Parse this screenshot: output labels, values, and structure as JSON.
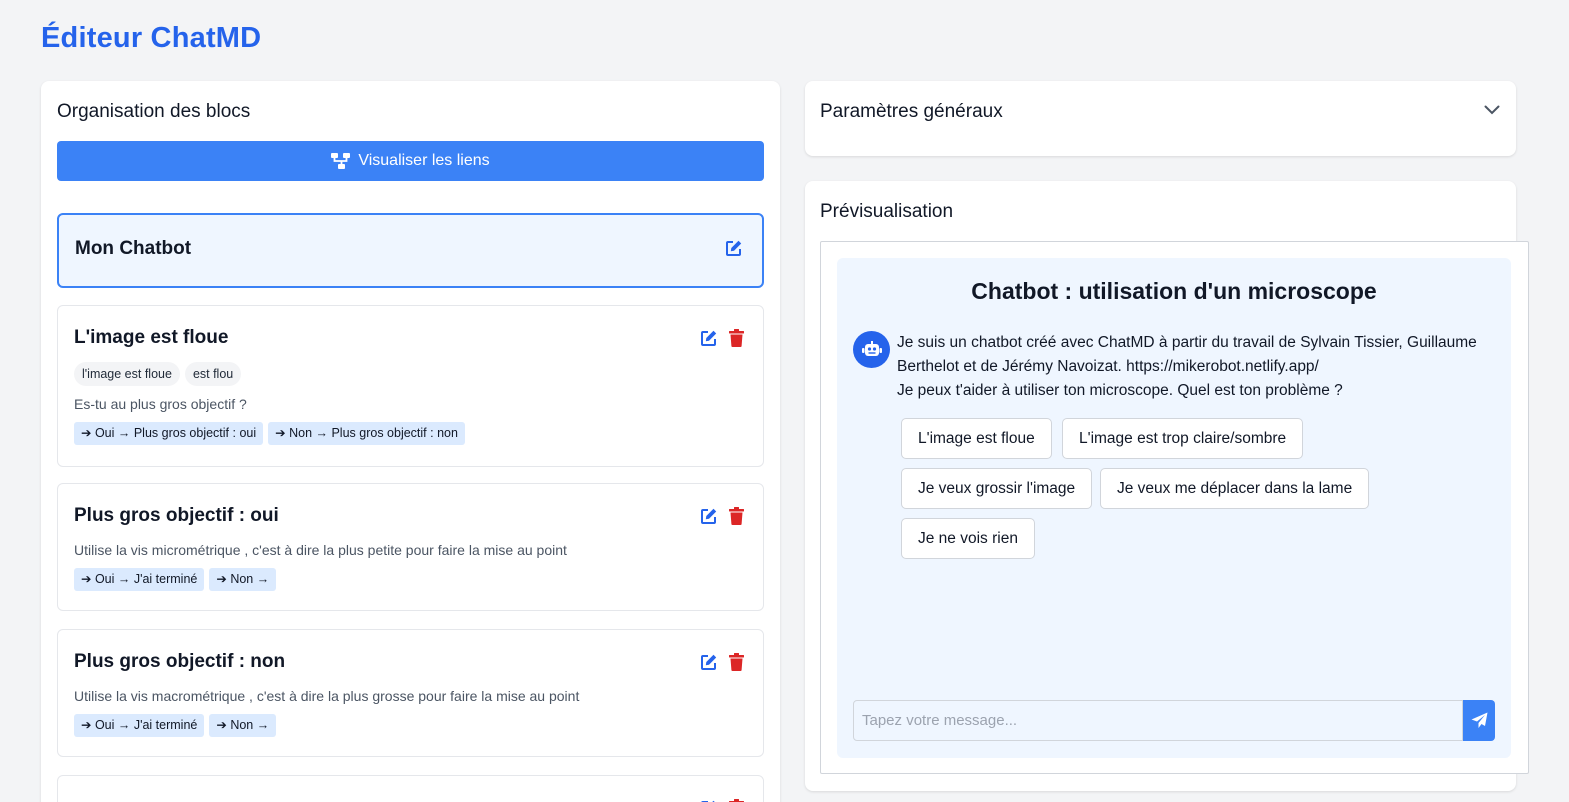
{
  "app": {
    "title": "Éditeur ChatMD"
  },
  "colors": {
    "accent": "#3b82f6",
    "title": "#2563eb",
    "danger": "#dc2626",
    "preview_bg": "#eff6ff"
  },
  "organisation": {
    "title": "Organisation des blocs",
    "visualize_label": "Visualiser les liens",
    "root_block": {
      "title": "Mon Chatbot"
    },
    "blocks": [
      {
        "title": "L'image est floue",
        "keywords": [
          "l'image est floue",
          "est flou"
        ],
        "question": "Es-tu au plus gros objectif ?",
        "links": [
          "➔ Oui → Plus gros objectif : oui",
          "➔ Non → Plus gros objectif : non"
        ]
      },
      {
        "title": "Plus gros objectif : oui",
        "keywords": [],
        "question": "Utilise la vis micrométrique , c'est à dire la plus petite pour faire la mise au point",
        "links": [
          "➔ Oui → J'ai terminé",
          "➔ Non →"
        ]
      },
      {
        "title": "Plus gros objectif : non",
        "keywords": [],
        "question": "Utilise la vis macrométrique , c'est à dire la plus grosse pour faire la mise au point",
        "links": [
          "➔ Oui → J'ai terminé",
          "➔ Non →"
        ]
      }
    ]
  },
  "settings": {
    "title": "Paramètres généraux",
    "icon": "chevron-down-icon"
  },
  "preview": {
    "title": "Prévisualisation",
    "chat_title": "Chatbot : utilisation d'un microscope",
    "bot_message_line1": "Je suis un chatbot créé avec ChatMD à partir du travail de Sylvain Tissier, Guillaume Berthelot et de Jérémy Navoizat. https://mikerobot.netlify.app/",
    "bot_message_line2": "Je peux t'aider à utiliser ton microscope. Quel est ton problème ?",
    "choices": [
      "L'image est floue",
      "L'image est trop claire/sombre",
      "Je veux grossir l'image",
      "Je veux me déplacer dans la lame",
      "Je ne vois rien"
    ],
    "input_placeholder": "Tapez votre message..."
  }
}
